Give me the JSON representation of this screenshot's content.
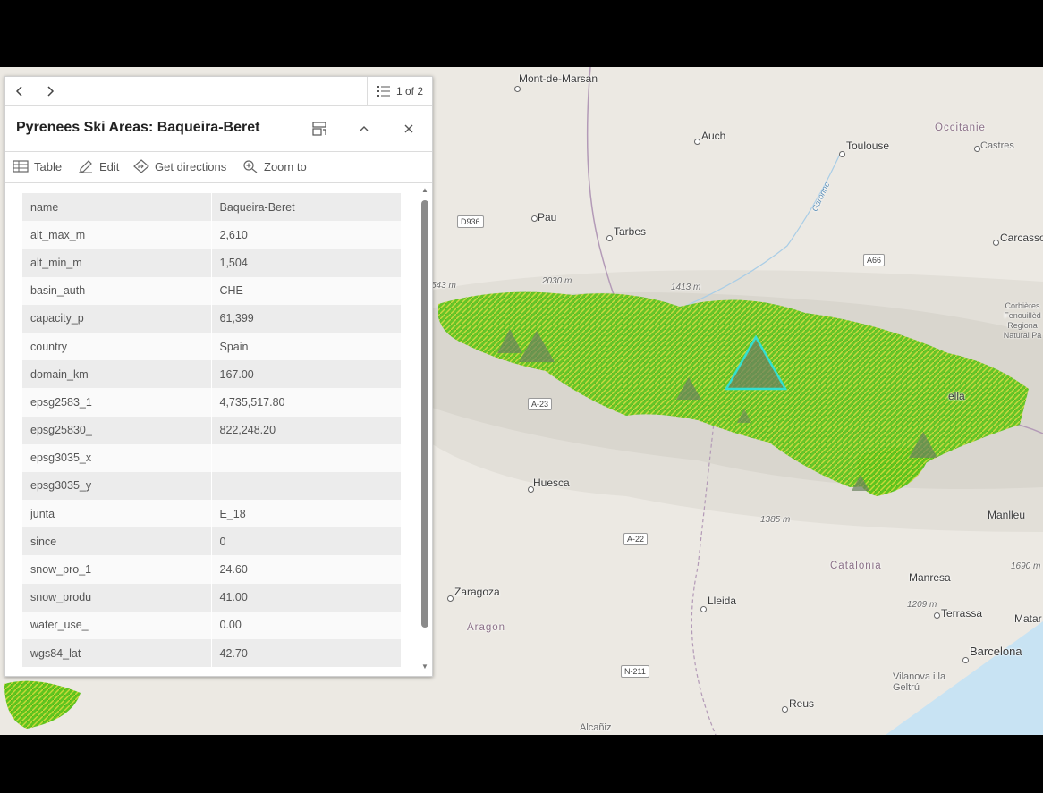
{
  "popup": {
    "prev_icon": "chevron-left-icon",
    "next_icon": "chevron-right-icon",
    "feature_count": "1 of 2",
    "title": "Pyrenees Ski Areas: Baqueira-Beret",
    "actions": {
      "table": "Table",
      "edit": "Edit",
      "directions": "Get directions",
      "zoom": "Zoom to"
    },
    "attributes": [
      {
        "k": "name",
        "v": "Baqueira-Beret"
      },
      {
        "k": "alt_max_m",
        "v": "2,610"
      },
      {
        "k": "alt_min_m",
        "v": "1,504"
      },
      {
        "k": "basin_auth",
        "v": "CHE"
      },
      {
        "k": "capacity_p",
        "v": "61,399"
      },
      {
        "k": "country",
        "v": "Spain"
      },
      {
        "k": "domain_km",
        "v": "167.00"
      },
      {
        "k": "epsg2583_1",
        "v": "4,735,517.80"
      },
      {
        "k": "epsg25830_",
        "v": "822,248.20"
      },
      {
        "k": "epsg3035_x",
        "v": ""
      },
      {
        "k": "epsg3035_y",
        "v": ""
      },
      {
        "k": "junta",
        "v": "E_18"
      },
      {
        "k": "since",
        "v": "0"
      },
      {
        "k": "snow_pro_1",
        "v": "24.60"
      },
      {
        "k": "snow_produ",
        "v": "41.00"
      },
      {
        "k": "water_use_",
        "v": "0.00"
      },
      {
        "k": "wgs84_lat",
        "v": "42.70"
      }
    ]
  },
  "map": {
    "places": {
      "mont_de_marsan": "Mont-de-Marsan",
      "auch": "Auch",
      "toulouse": "Toulouse",
      "occitanie": "Occitanie",
      "castres": "Castres",
      "pau": "Pau",
      "tarbes": "Tarbes",
      "carcasso": "Carcasso",
      "corbieres": "Corbières Fenouillèd Regiona Natural Pa",
      "huesca": "Huesca",
      "zaragoza": "Zaragoza",
      "aragon": "Aragon",
      "lleida": "Lleida",
      "catalonia": "Catalonia",
      "manlleu": "Manlleu",
      "manresa": "Manresa",
      "terrassa": "Terrassa",
      "matar": "Matar",
      "barcelona": "Barcelona",
      "vilanova": "Vilanova i la Geltrú",
      "reus": "Reus",
      "alcaniz": "Alcañiz",
      "garonne": "Garonne",
      "ella": "ella"
    },
    "elevations": {
      "e543": "543 m",
      "e2030": "2030 m",
      "e1413": "1413 m",
      "e1385": "1385 m",
      "e1209": "1209 m",
      "e1690": "1690 m"
    },
    "roads": {
      "d936": "D936",
      "a66": "A66",
      "a23": "A-23",
      "a22": "A-22",
      "n211": "N-211"
    },
    "colors": {
      "map_bg": "#ece9e3",
      "vegetation": "#5fc41e",
      "vegetation_light": "#c9d93a",
      "selected_outline": "#33e0d0",
      "ski_marker": "#6b8060",
      "sea": "#c8e3f3"
    }
  }
}
